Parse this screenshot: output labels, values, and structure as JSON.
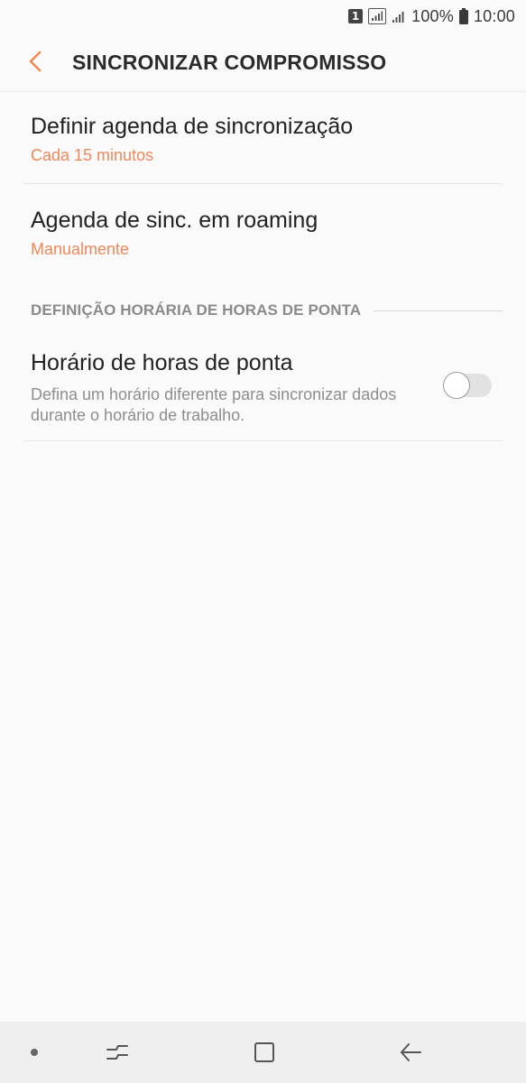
{
  "status_bar": {
    "sim_label": "1",
    "battery_percent": "100%",
    "time": "10:00",
    "icons": [
      "sim-1-icon",
      "signal-boxed-icon",
      "signal-icon",
      "battery-icon"
    ]
  },
  "app_bar": {
    "title": "SINCRONIZAR COMPROMISSO",
    "back_icon": "chevron-left-icon",
    "accent_color": "#f0885a"
  },
  "settings": {
    "sync_schedule": {
      "title": "Definir agenda de sincronização",
      "value": "Cada 15 minutos"
    },
    "roaming_schedule": {
      "title": "Agenda de sinc. em roaming",
      "value": "Manualmente"
    },
    "peak_section": {
      "header": "DEFINIÇÃO HORÁRIA DE HORAS DE PONTA"
    },
    "peak_schedule": {
      "title": "Horário de horas de ponta",
      "description": "Defina um horário diferente para sincronizar dados durante o horário de trabalho.",
      "enabled": false
    }
  },
  "nav_bar": {
    "icons": [
      "dot-icon",
      "recent-apps-icon",
      "home-icon",
      "back-arrow-icon"
    ]
  }
}
